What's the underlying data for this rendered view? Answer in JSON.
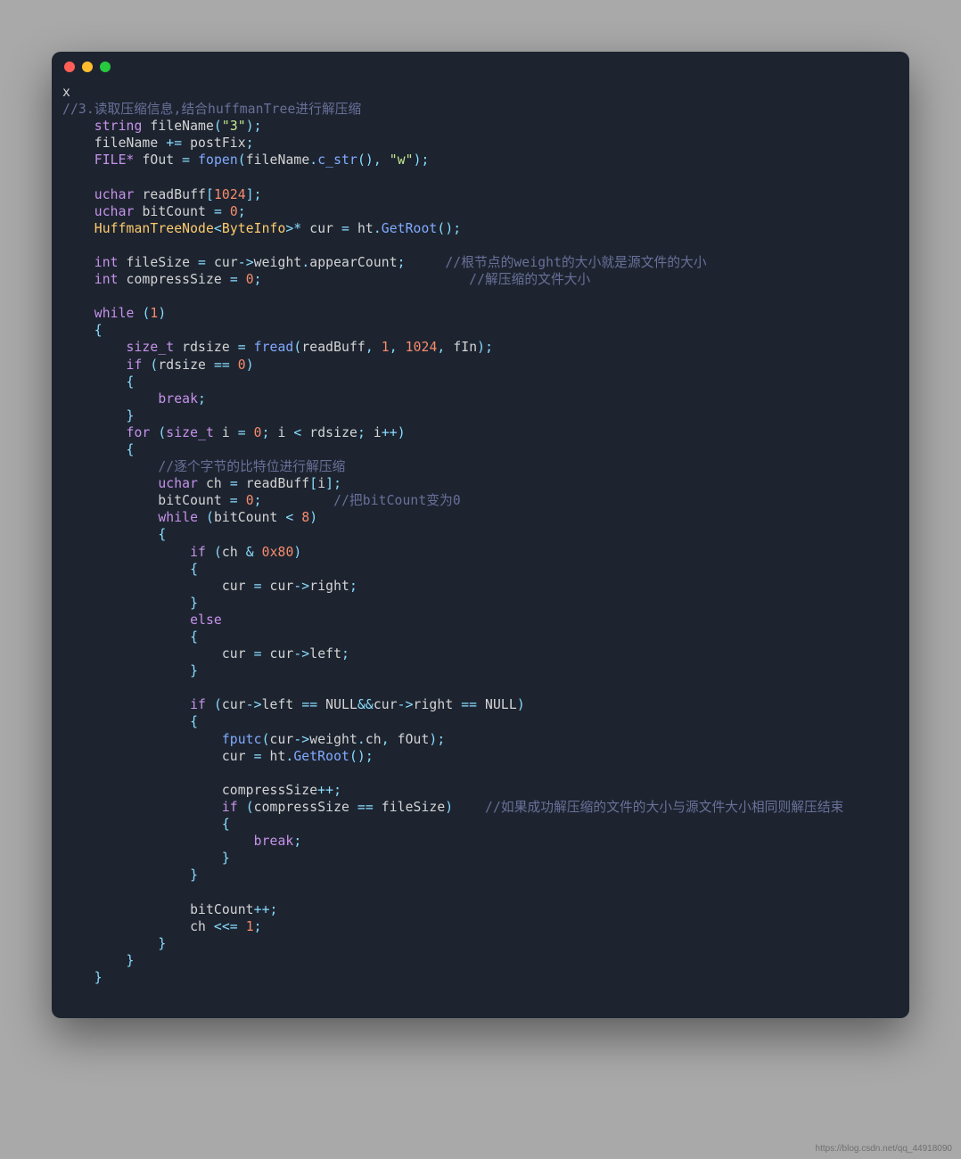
{
  "window": {
    "dot_red": "close",
    "dot_yellow": "minimize",
    "dot_green": "zoom"
  },
  "code": {
    "lines": [
      [
        [
          "v",
          "x"
        ]
      ],
      [
        [
          "c",
          "//3.读取压缩信息,结合huffmanTree进行解压缩"
        ]
      ],
      [
        [
          "v",
          "    "
        ],
        [
          "k",
          "string"
        ],
        [
          "v",
          " fileName"
        ],
        [
          "o",
          "("
        ],
        [
          "s",
          "\"3\""
        ],
        [
          "o",
          ")"
        ],
        [
          "o",
          ";"
        ]
      ],
      [
        [
          "v",
          "    fileName "
        ],
        [
          "o",
          "+="
        ],
        [
          "v",
          " postFix"
        ],
        [
          "o",
          ";"
        ]
      ],
      [
        [
          "v",
          "    "
        ],
        [
          "k",
          "FILE*"
        ],
        [
          "v",
          " fOut "
        ],
        [
          "o",
          "="
        ],
        [
          "v",
          " "
        ],
        [
          "f",
          "fopen"
        ],
        [
          "o",
          "("
        ],
        [
          "v",
          "fileName"
        ],
        [
          "o",
          "."
        ],
        [
          "f",
          "c_str"
        ],
        [
          "o",
          "()"
        ],
        [
          "o",
          ","
        ],
        [
          "v",
          " "
        ],
        [
          "s",
          "\"w\""
        ],
        [
          "o",
          ")"
        ],
        [
          "o",
          ";"
        ]
      ],
      [
        [
          "v",
          ""
        ]
      ],
      [
        [
          "v",
          "    "
        ],
        [
          "k",
          "uchar"
        ],
        [
          "v",
          " readBuff"
        ],
        [
          "o",
          "["
        ],
        [
          "n",
          "1024"
        ],
        [
          "o",
          "]"
        ],
        [
          "o",
          ";"
        ]
      ],
      [
        [
          "v",
          "    "
        ],
        [
          "k",
          "uchar"
        ],
        [
          "v",
          " bitCount "
        ],
        [
          "o",
          "="
        ],
        [
          "v",
          " "
        ],
        [
          "n",
          "0"
        ],
        [
          "o",
          ";"
        ]
      ],
      [
        [
          "v",
          "    "
        ],
        [
          "m",
          "HuffmanTreeNode"
        ],
        [
          "o",
          "<"
        ],
        [
          "m",
          "ByteInfo"
        ],
        [
          "o",
          ">"
        ],
        [
          "o",
          "*"
        ],
        [
          "v",
          " cur "
        ],
        [
          "o",
          "="
        ],
        [
          "v",
          " ht"
        ],
        [
          "o",
          "."
        ],
        [
          "f",
          "GetRoot"
        ],
        [
          "o",
          "()"
        ],
        [
          "o",
          ";"
        ]
      ],
      [
        [
          "v",
          ""
        ]
      ],
      [
        [
          "v",
          "    "
        ],
        [
          "k",
          "int"
        ],
        [
          "v",
          " fileSize "
        ],
        [
          "o",
          "="
        ],
        [
          "v",
          " cur"
        ],
        [
          "o",
          "->"
        ],
        [
          "v",
          "weight"
        ],
        [
          "o",
          "."
        ],
        [
          "v",
          "appearCount"
        ],
        [
          "o",
          ";"
        ],
        [
          "v",
          "     "
        ],
        [
          "c",
          "//根节点的weight的大小就是源文件的大小"
        ]
      ],
      [
        [
          "v",
          "    "
        ],
        [
          "k",
          "int"
        ],
        [
          "v",
          " compressSize "
        ],
        [
          "o",
          "="
        ],
        [
          "v",
          " "
        ],
        [
          "n",
          "0"
        ],
        [
          "o",
          ";"
        ],
        [
          "v",
          "                          "
        ],
        [
          "c",
          "//解压缩的文件大小"
        ]
      ],
      [
        [
          "v",
          ""
        ]
      ],
      [
        [
          "v",
          "    "
        ],
        [
          "k",
          "while"
        ],
        [
          "v",
          " "
        ],
        [
          "o",
          "("
        ],
        [
          "n",
          "1"
        ],
        [
          "o",
          ")"
        ]
      ],
      [
        [
          "v",
          "    "
        ],
        [
          "o",
          "{"
        ]
      ],
      [
        [
          "v",
          "        "
        ],
        [
          "k",
          "size_t"
        ],
        [
          "v",
          " rdsize "
        ],
        [
          "o",
          "="
        ],
        [
          "v",
          " "
        ],
        [
          "f",
          "fread"
        ],
        [
          "o",
          "("
        ],
        [
          "v",
          "readBuff"
        ],
        [
          "o",
          ","
        ],
        [
          "v",
          " "
        ],
        [
          "n",
          "1"
        ],
        [
          "o",
          ","
        ],
        [
          "v",
          " "
        ],
        [
          "n",
          "1024"
        ],
        [
          "o",
          ","
        ],
        [
          "v",
          " fIn"
        ],
        [
          "o",
          ")"
        ],
        [
          "o",
          ";"
        ]
      ],
      [
        [
          "v",
          "        "
        ],
        [
          "k",
          "if"
        ],
        [
          "v",
          " "
        ],
        [
          "o",
          "("
        ],
        [
          "v",
          "rdsize "
        ],
        [
          "o",
          "=="
        ],
        [
          "v",
          " "
        ],
        [
          "n",
          "0"
        ],
        [
          "o",
          ")"
        ]
      ],
      [
        [
          "v",
          "        "
        ],
        [
          "o",
          "{"
        ]
      ],
      [
        [
          "v",
          "            "
        ],
        [
          "k",
          "break"
        ],
        [
          "o",
          ";"
        ]
      ],
      [
        [
          "v",
          "        "
        ],
        [
          "o",
          "}"
        ]
      ],
      [
        [
          "v",
          "        "
        ],
        [
          "k",
          "for"
        ],
        [
          "v",
          " "
        ],
        [
          "o",
          "("
        ],
        [
          "k",
          "size_t"
        ],
        [
          "v",
          " i "
        ],
        [
          "o",
          "="
        ],
        [
          "v",
          " "
        ],
        [
          "n",
          "0"
        ],
        [
          "o",
          ";"
        ],
        [
          "v",
          " i "
        ],
        [
          "o",
          "<"
        ],
        [
          "v",
          " rdsize"
        ],
        [
          "o",
          ";"
        ],
        [
          "v",
          " i"
        ],
        [
          "o",
          "++"
        ],
        [
          "o",
          ")"
        ]
      ],
      [
        [
          "v",
          "        "
        ],
        [
          "o",
          "{"
        ]
      ],
      [
        [
          "v",
          "            "
        ],
        [
          "c",
          "//逐个字节的比特位进行解压缩"
        ]
      ],
      [
        [
          "v",
          "            "
        ],
        [
          "k",
          "uchar"
        ],
        [
          "v",
          " ch "
        ],
        [
          "o",
          "="
        ],
        [
          "v",
          " readBuff"
        ],
        [
          "o",
          "["
        ],
        [
          "v",
          "i"
        ],
        [
          "o",
          "]"
        ],
        [
          "o",
          ";"
        ]
      ],
      [
        [
          "v",
          "            bitCount "
        ],
        [
          "o",
          "="
        ],
        [
          "v",
          " "
        ],
        [
          "n",
          "0"
        ],
        [
          "o",
          ";"
        ],
        [
          "v",
          "         "
        ],
        [
          "c",
          "//把bitCount变为0"
        ]
      ],
      [
        [
          "v",
          "            "
        ],
        [
          "k",
          "while"
        ],
        [
          "v",
          " "
        ],
        [
          "o",
          "("
        ],
        [
          "v",
          "bitCount "
        ],
        [
          "o",
          "<"
        ],
        [
          "v",
          " "
        ],
        [
          "n",
          "8"
        ],
        [
          "o",
          ")"
        ]
      ],
      [
        [
          "v",
          "            "
        ],
        [
          "o",
          "{"
        ]
      ],
      [
        [
          "v",
          "                "
        ],
        [
          "k",
          "if"
        ],
        [
          "v",
          " "
        ],
        [
          "o",
          "("
        ],
        [
          "v",
          "ch "
        ],
        [
          "o",
          "&"
        ],
        [
          "v",
          " "
        ],
        [
          "n",
          "0x80"
        ],
        [
          "o",
          ")"
        ]
      ],
      [
        [
          "v",
          "                "
        ],
        [
          "o",
          "{"
        ]
      ],
      [
        [
          "v",
          "                    cur "
        ],
        [
          "o",
          "="
        ],
        [
          "v",
          " cur"
        ],
        [
          "o",
          "->"
        ],
        [
          "v",
          "right"
        ],
        [
          "o",
          ";"
        ]
      ],
      [
        [
          "v",
          "                "
        ],
        [
          "o",
          "}"
        ]
      ],
      [
        [
          "v",
          "                "
        ],
        [
          "k",
          "else"
        ]
      ],
      [
        [
          "v",
          "                "
        ],
        [
          "o",
          "{"
        ]
      ],
      [
        [
          "v",
          "                    cur "
        ],
        [
          "o",
          "="
        ],
        [
          "v",
          " cur"
        ],
        [
          "o",
          "->"
        ],
        [
          "v",
          "left"
        ],
        [
          "o",
          ";"
        ]
      ],
      [
        [
          "v",
          "                "
        ],
        [
          "o",
          "}"
        ]
      ],
      [
        [
          "v",
          ""
        ]
      ],
      [
        [
          "v",
          "                "
        ],
        [
          "k",
          "if"
        ],
        [
          "v",
          " "
        ],
        [
          "o",
          "("
        ],
        [
          "v",
          "cur"
        ],
        [
          "o",
          "->"
        ],
        [
          "v",
          "left "
        ],
        [
          "o",
          "=="
        ],
        [
          "v",
          " NULL"
        ],
        [
          "o",
          "&&"
        ],
        [
          "v",
          "cur"
        ],
        [
          "o",
          "->"
        ],
        [
          "v",
          "right "
        ],
        [
          "o",
          "=="
        ],
        [
          "v",
          " NULL"
        ],
        [
          "o",
          ")"
        ]
      ],
      [
        [
          "v",
          "                "
        ],
        [
          "o",
          "{"
        ]
      ],
      [
        [
          "v",
          "                    "
        ],
        [
          "f",
          "fputc"
        ],
        [
          "o",
          "("
        ],
        [
          "v",
          "cur"
        ],
        [
          "o",
          "->"
        ],
        [
          "v",
          "weight"
        ],
        [
          "o",
          "."
        ],
        [
          "v",
          "ch"
        ],
        [
          "o",
          ","
        ],
        [
          "v",
          " fOut"
        ],
        [
          "o",
          ")"
        ],
        [
          "o",
          ";"
        ]
      ],
      [
        [
          "v",
          "                    cur "
        ],
        [
          "o",
          "="
        ],
        [
          "v",
          " ht"
        ],
        [
          "o",
          "."
        ],
        [
          "f",
          "GetRoot"
        ],
        [
          "o",
          "()"
        ],
        [
          "o",
          ";"
        ]
      ],
      [
        [
          "v",
          ""
        ]
      ],
      [
        [
          "v",
          "                    compressSize"
        ],
        [
          "o",
          "++"
        ],
        [
          "o",
          ";"
        ]
      ],
      [
        [
          "v",
          "                    "
        ],
        [
          "k",
          "if"
        ],
        [
          "v",
          " "
        ],
        [
          "o",
          "("
        ],
        [
          "v",
          "compressSize "
        ],
        [
          "o",
          "=="
        ],
        [
          "v",
          " fileSize"
        ],
        [
          "o",
          ")"
        ],
        [
          "v",
          "    "
        ],
        [
          "c",
          "//如果成功解压缩的文件的大小与源文件大小相同则解压结束"
        ]
      ],
      [
        [
          "v",
          "                    "
        ],
        [
          "o",
          "{"
        ]
      ],
      [
        [
          "v",
          "                        "
        ],
        [
          "k",
          "break"
        ],
        [
          "o",
          ";"
        ]
      ],
      [
        [
          "v",
          "                    "
        ],
        [
          "o",
          "}"
        ]
      ],
      [
        [
          "v",
          "                "
        ],
        [
          "o",
          "}"
        ]
      ],
      [
        [
          "v",
          ""
        ]
      ],
      [
        [
          "v",
          "                bitCount"
        ],
        [
          "o",
          "++"
        ],
        [
          "o",
          ";"
        ]
      ],
      [
        [
          "v",
          "                ch "
        ],
        [
          "o",
          "<<="
        ],
        [
          "v",
          " "
        ],
        [
          "n",
          "1"
        ],
        [
          "o",
          ";"
        ]
      ],
      [
        [
          "v",
          "            "
        ],
        [
          "o",
          "}"
        ]
      ],
      [
        [
          "v",
          "        "
        ],
        [
          "o",
          "}"
        ]
      ],
      [
        [
          "v",
          "    "
        ],
        [
          "o",
          "}"
        ]
      ]
    ]
  },
  "footer": {
    "url": "https://blog.csdn.net/qq_44918090"
  }
}
